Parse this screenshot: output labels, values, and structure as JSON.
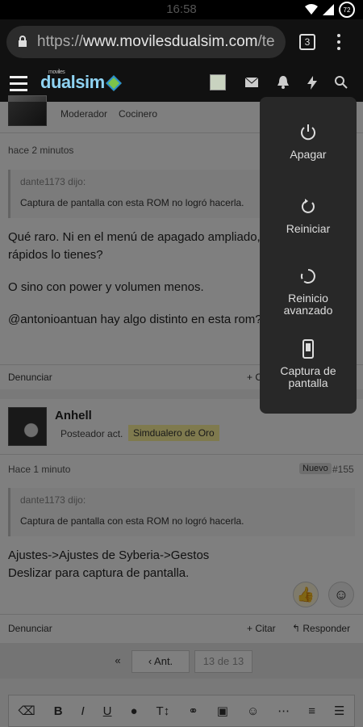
{
  "status": {
    "time": "16:58",
    "battery": "72"
  },
  "browser": {
    "url_prefix": "https://",
    "url_domain": "www.movilesdualsim.com",
    "url_tail": "/te",
    "tab_count": "3"
  },
  "site": {
    "logo_small": "moviles",
    "logo_main": "dualsim"
  },
  "post1": {
    "role": "Moderador",
    "title": "Cocinero",
    "time": "hace 2 minutos",
    "quote_author": "dante1173 dijo:",
    "quote_text": "Captura de pantalla con esta ROM no logró hacerla.",
    "body_1": "Qué raro. Ni en el menú de apagado ampliado, o",
    "body_2": "rápidos lo tienes?",
    "body_3": "O sino con power y volumen menos.",
    "body_4": "@antonioantuan hay algo distinto en esta rom?",
    "report": "Denunciar",
    "cite": "+ C"
  },
  "post2": {
    "username": "Anhell",
    "role": "Posteador act.",
    "badge": "Simdualero de Oro",
    "time": "Hace 1 minuto",
    "new_badge": "Nuevo",
    "number": "#155",
    "quote_author": "dante1173 dijo:",
    "quote_text": "Captura de pantalla con esta ROM no logró hacerla.",
    "body_1": "Ajustes->Ajustes de Syberia->Gestos",
    "body_2": "Deslizar para captura de pantalla.",
    "report": "Denunciar",
    "cite": "+ Citar",
    "reply": "Responder"
  },
  "pager": {
    "prev": "Ant.",
    "pages": "13 de 13"
  },
  "power_menu": {
    "off": "Apagar",
    "restart": "Reiniciar",
    "advanced_1": "Reinicio",
    "advanced_2": "avanzado",
    "screenshot_1": "Captura de",
    "screenshot_2": "pantalla"
  }
}
